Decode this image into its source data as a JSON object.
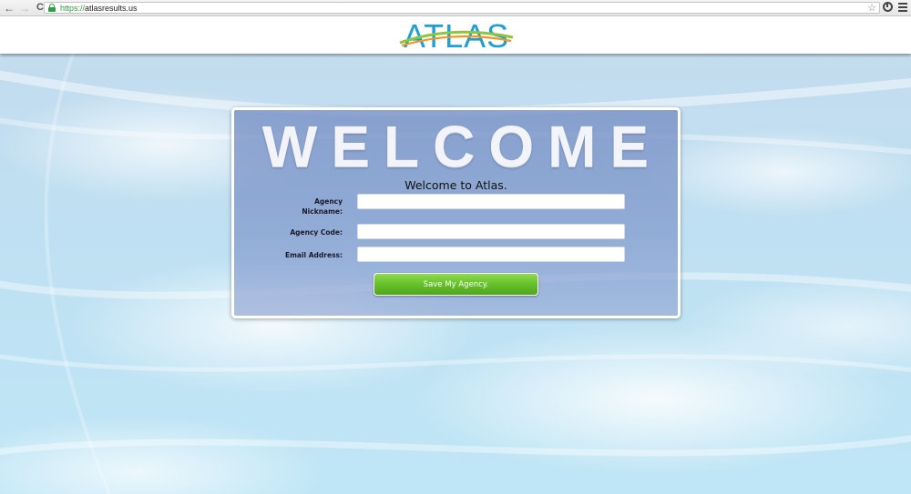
{
  "browser": {
    "url_scheme": "https://",
    "url_host": "atlasresults.us",
    "back_glyph": "←",
    "forward_glyph": "→",
    "reload_glyph": "C",
    "star_glyph": "☆",
    "icons": [
      "back-arrow-icon",
      "forward-arrow-icon",
      "reload-icon",
      "lock-icon",
      "bookmark-star-icon",
      "extension-icon",
      "menu-icon"
    ]
  },
  "header": {
    "logo_text": "ATLAS",
    "logo_colors": {
      "letters": "#1b9fd6",
      "swoosh_green": "#8cc63f",
      "swoosh_orange": "#f7941d"
    }
  },
  "panel": {
    "banner": "WELCOME",
    "subtitle": "Welcome to Atlas.",
    "fields": [
      {
        "label_line1": "Agency",
        "label_line2": "Nickname:",
        "value": "",
        "placeholder": ""
      },
      {
        "label": "Agency Code:",
        "value": "",
        "placeholder": ""
      },
      {
        "label": "Email Address:",
        "value": "",
        "placeholder": ""
      }
    ],
    "submit_label": "Save My Agency."
  },
  "colors": {
    "panel_tint": "#7f98cc",
    "button_green": "#65c02a",
    "sky": "#c3dcee"
  }
}
